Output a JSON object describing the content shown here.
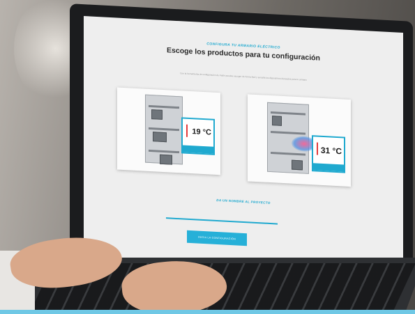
{
  "screen": {
    "subtitle": "CONFIGURA TU ARMARIO ELÉCTRICO",
    "title": "Escoge los productos para tu configuración",
    "description": "Con la herramienta de configuración de Fadin puedes escoger de forma fácil y sencilla los dispositivos deseados para tu armario",
    "cards": [
      {
        "temperature": "19 °C"
      },
      {
        "temperature": "31 °C"
      }
    ],
    "project_label": "DA UN NOMBRE AL PROYECTO",
    "start_button": "INICIA LA CONFIGURACIÓN"
  },
  "colors": {
    "accent": "#1fa9cf",
    "title_text": "#2a2a2a",
    "screen_bg": "#eeeeee"
  }
}
